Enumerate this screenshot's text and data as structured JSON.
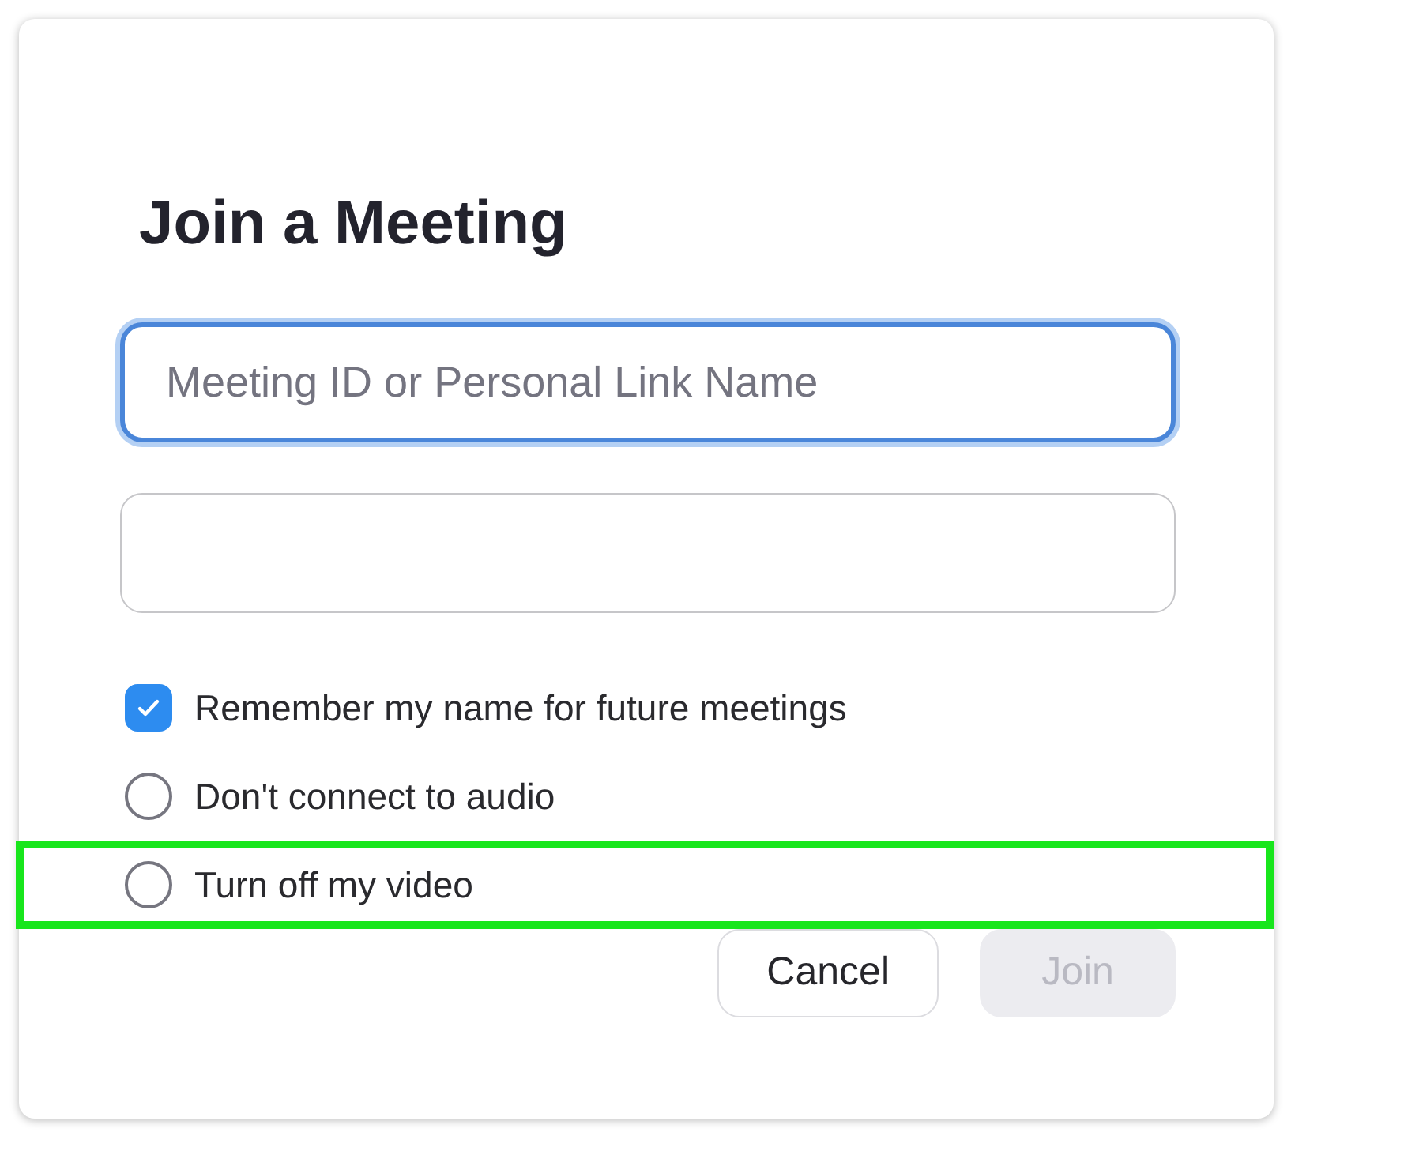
{
  "dialog": {
    "title": "Join a Meeting",
    "fields": [
      {
        "placeholder": "Meeting ID or Personal Link Name",
        "focused": true
      },
      {
        "focused": false
      }
    ],
    "options": [
      {
        "label": "Remember my name for future meetings",
        "checked": true,
        "highlighted": false
      },
      {
        "label": "Don't connect to audio",
        "checked": false,
        "highlighted": false
      },
      {
        "label": "Turn off my video",
        "checked": false,
        "highlighted": true
      }
    ],
    "buttons": [
      {
        "label": "Cancel",
        "disabled": false
      },
      {
        "label": "Join",
        "disabled": true
      }
    ]
  }
}
